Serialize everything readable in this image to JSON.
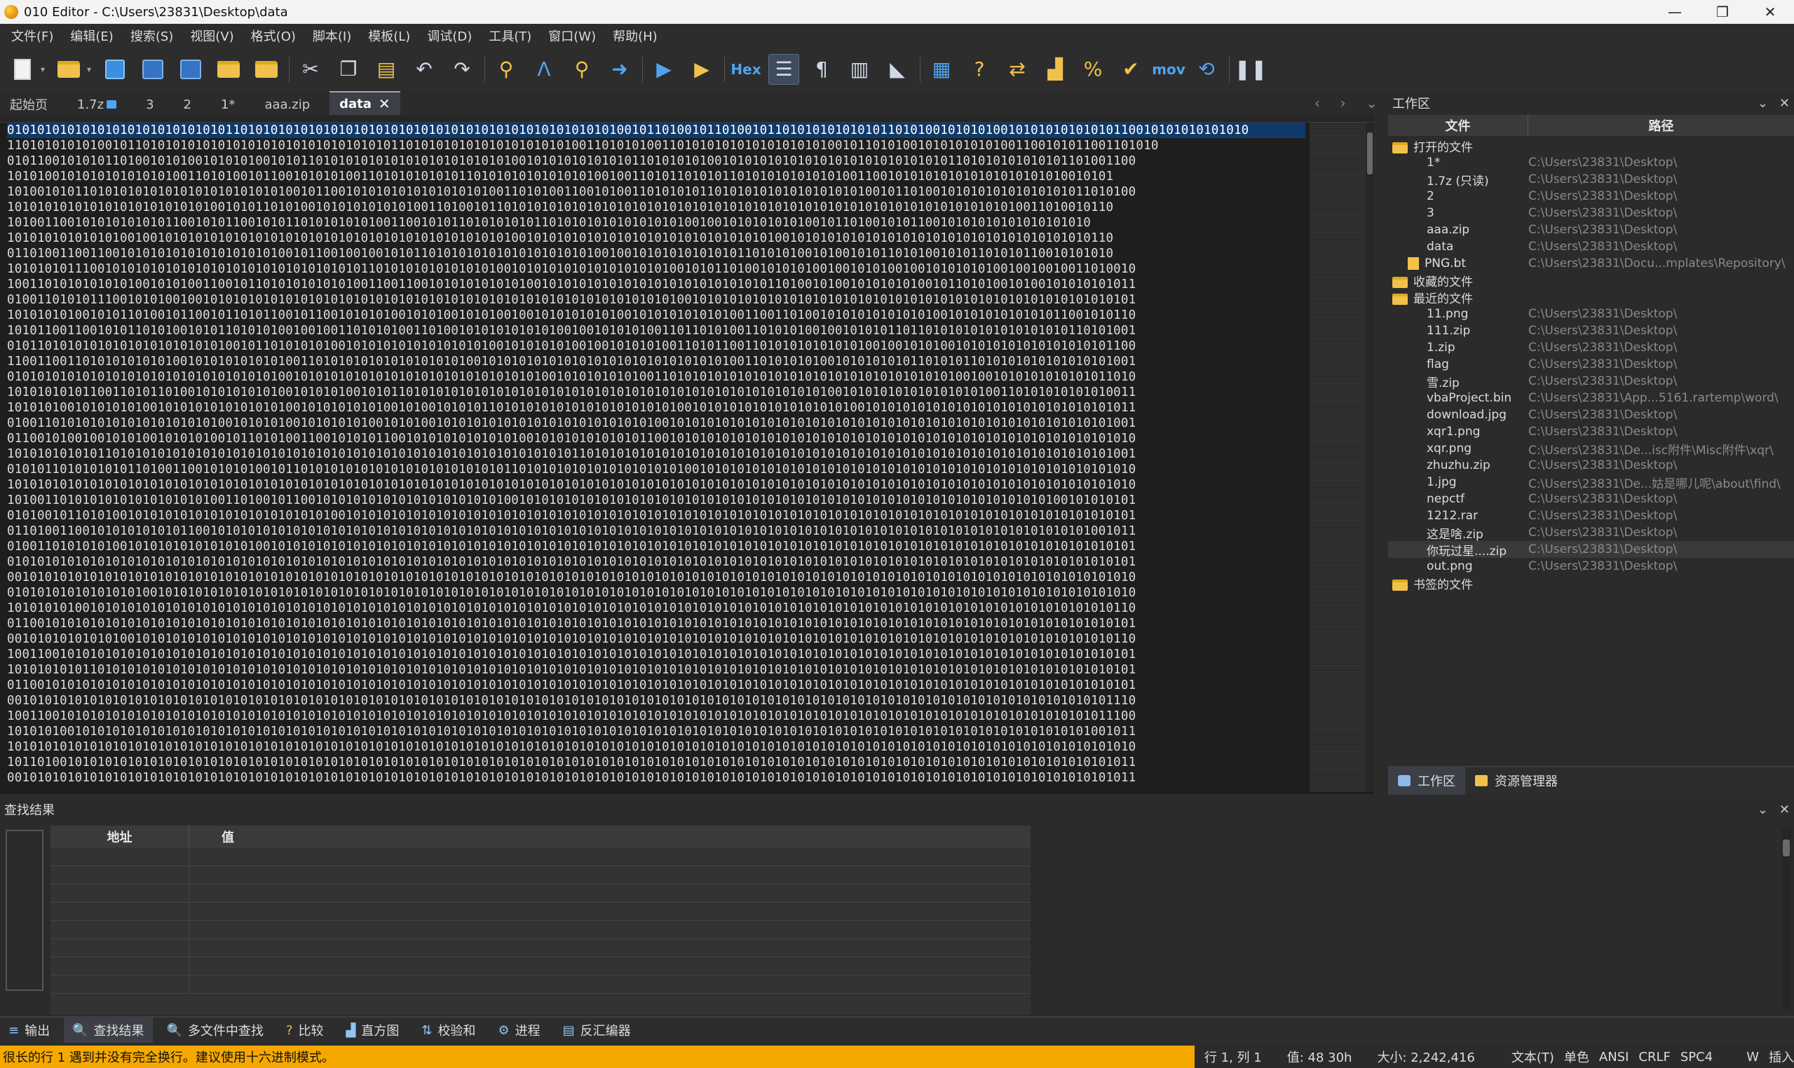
{
  "window": {
    "title": "010 Editor - C:\\Users\\23831\\Desktop\\data",
    "minimize": "—",
    "maximize": "❐",
    "close": "✕"
  },
  "menu": [
    "文件(F)",
    "编辑(E)",
    "搜索(S)",
    "视图(V)",
    "格式(O)",
    "脚本(I)",
    "模板(L)",
    "调试(D)",
    "工具(T)",
    "窗口(W)",
    "帮助(H)"
  ],
  "toolbar": {
    "hex_label": "Hex",
    "mov_label": "mov",
    "icons": [
      "new-file-icon",
      "open-folder-icon",
      "save-icon",
      "save-as-icon",
      "save-all-icon",
      "open-folder2-icon",
      "workspace-folder-icon",
      "cut-icon",
      "copy-icon",
      "paste-icon",
      "undo-icon",
      "redo-icon",
      "find-icon",
      "replace-icon",
      "find-in-files-icon",
      "goto-icon",
      "run-script-icon",
      "run-template-icon",
      "hex-mode-icon",
      "text-mode-icon",
      "show-whitespace-icon",
      "columns-icon",
      "highlight-icon",
      "calculator-icon",
      "inspector-icon",
      "compare-icon",
      "histogram-icon",
      "checksum-icon",
      "verify-icon",
      "disassembler-icon",
      "base-converter-icon",
      "pause-icon"
    ]
  },
  "tabs": [
    {
      "label": "起始页",
      "active": false,
      "locked": false
    },
    {
      "label": "1.7z",
      "active": false,
      "locked": true
    },
    {
      "label": "3",
      "active": false,
      "locked": false
    },
    {
      "label": "2",
      "active": false,
      "locked": false
    },
    {
      "label": "1*",
      "active": false,
      "locked": false
    },
    {
      "label": "aaa.zip",
      "active": false,
      "locked": false
    },
    {
      "label": "data",
      "active": true,
      "locked": false
    }
  ],
  "tab_close": "✕",
  "tab_nav": {
    "prev": "‹",
    "next": "›",
    "list": "⌄"
  },
  "editor": {
    "line_count": 43,
    "lines": [
      "010101010101010101010101010101101010101010101010101010101010101010101010101010101001011010010110100101101010101010101101010010101010010101010101010110010101010101010",
      "110101010101001011010101010101010101010101010101010110101010101010101010101001101010100110101010101010101010100101101010010101010101001100101011001101010",
      "010110010101011010010101001010101001010110101010101010101010101010100101010101010101101010101001010101010101010101010101010101101010101010101101001100",
      "101010010101010101010100110101001011001010101001101010101010110101010101010101001001101011010101101010101010101001100101010101010101010101010010101",
      "101001010110101010101010101010101010100101100101010101010101010100110101001100101001101010101101010101010101010101001011010010101010101010101011010100",
      "101010101010101010101010101001010110101001010101010101001101001011010101010101010101010101010101010101010101010101010101010101010101010011010010110",
      "101001100101010101010110010101100101011010101010100110010101101010101011010101010101010101001001010101010100101101001010110010101010101010101010",
      "101010101010101001001010101010101010101010101010101010101010101010100101010101010101010101010101010101001010101010101010101010101010101010101010110",
      "011010011001100101010101010101010101001011001001001010110101010101010101010101001001010101010101011010101001010010101101010010101101010110010101010",
      "101010101110010101010101010101010101010101010101101010101010101010010101010101010101010100101011010010101010010010101001001010101010010010010011010010",
      "100110101010101010010101001100101101010101010100110011001010101010101001010101010101010101010101010101101001010010101010100101101010010100101010101011",
      "010011010101110010101001001010101010101010101010101010101010101010101010101010101010101010010101010101010101010101010101010101010101010101010101010101",
      "101010101001010110100101100101101011001011001010101001010100101010010010101010101001010101010101001100110100101010101010101001010101010101011001010110",
      "101011001100101011010100101011010101001001001101010100110100101010101010100100101010100110110101001101010100100101010110110101010101010101010110101001",
      "010110101010101010101010101010010110101010100101010101010101010100101010101001001010101001101011001101010101010101001001010100101010101010101010101100",
      "110011001101010101010100101010101010100110101010101010101010100101010101010101010101010101010101001101010101001010101010110101011010101010101010101001",
      "010101010101010101010101010101010101001010101010101010101010101010101010010101010101001101010101010101010101010101010101010101001001010101010101011010",
      "101010101011001101011010010101010101001010101001010110101010101010101010101010101010101010101010101010101010100101010101010101010100110101010101010011",
      "101010100101010101001010101010101010100101010101010010100101010110101010101010101010101010010101010101010101010100101010101010101010101010101010101011",
      "010011010101010101010101010100101010100101010101001010100101010101010101010101010101010010101010101010101010101010101010101010101010101010101010101001",
      "011001010010010101001010101001011010100110010101011001010101010101010010101010101010110010101010101010101010101010101010101010101010101010101010101010",
      "101010101010110101010101010101010101010101010101010101010101010101010101010110101010101010101010101010101010101010101010101010101010101010101010101001",
      "010101101010101011010011001010101001011010101010101010101010101010110101010101010101010101001010101010101010101010101010101010101010101010101010101010",
      "101010101010101010101010101010101010101010101010101010101010101010101010101010101010101010101010101010101010101010101010101010101010101010101010101010",
      "101001101010101010101010101001101001011001010101010101010101010101001010101010101010101010101010101010101010101010101010101010101010101010100101010101",
      "010100101101010010101010101010101010101010100101010101010101010101010101010101010101010101010101010101010101010101010101010101010101010101010101010101",
      "011010011001010101010101100101010101010101010101010101010101010101010101010101010101010101010101010101010101010101010101010101010101010101010101001011",
      "010011010101010010101010101010101001010101010101010101010101010101010101010101010101010101010101010101010101010101010101010101010101010101010101010101",
      "010101010101010101010101010101010101010101010101010101010101010101010101010101010101010101010101010101010101010101010101010101010101010101010101010101",
      "001010101010101010101010101010101010101010101010101010101010101010101010101010101010101010101010101010101010101010101010101010101010101010101010101010",
      "010101010101010101001010101010101010101010101010101010101010101010101010101010101010101010101010101010101010101010101010101010101010101010101010101010",
      "101010101001010101010101010101010101010101010101010101010101010101010101010101010101010101010101010101010101010101010101010101010101010101010101010110",
      "011001010101010101010101010101010101010101010101010101010101010101010101010101010101010101010101010101010101010101010101010101010101010101010101010101",
      "001010101010101001010101010101010101010101010101010101010101010101010101010101010101010101010101010101010101010101010101010101010101010101010101010110",
      "100110010101010101010101010101010101010101010101010101010101010101010101010101010101010101010101010101010101010101010101010101010101010101010101010101",
      "101010101011010101010101010101010101010101010101010101010101010101010101010101010101010101010101010101010101010101010101010101010101010101010101010101",
      "011001010101010101010101010101010101010101010101010101010101010101010101010101010101010101010101010101010101010101010101010101010101010101010101010101",
      "001010101010101010101010101010101010101010101010101010101010101010101010101010101010101010101010101010101010101010101010101010101010101010101010101110",
      "100110010101010101010101010101010101010101010101010101010101010101010101010101010101010101010101010101010101010101010101010101010101010101010101011100",
      "101010100101010101010101010101010101010101010101010101010101010101010101010101010101010101010101010101010101010101010101010101010101010101010101001011",
      "101010101010101010101010101010101010101010101010101010101010101010101010101010101010101010101010101010101010101010101010101010101010101010101010101010",
      "101101001010101010101010101010101010101010101010101010101010101010101010101010101010101010101010101010101010101010101010101010101010101010101010101011",
      "001010101010101010101010101010101010101010101010101010101010101010101010101010101010101010101010101010101010101010101010101010101010101010101010101011"
    ]
  },
  "workspace": {
    "title": "工作区",
    "col_file": "文件",
    "col_path": "路径",
    "groups": [
      {
        "label": "打开的文件",
        "items": [
          {
            "name": "1*",
            "path": "C:\\Users\\23831\\Desktop\\"
          },
          {
            "name": "1.7z (只读)",
            "path": "C:\\Users\\23831\\Desktop\\"
          },
          {
            "name": "2",
            "path": "C:\\Users\\23831\\Desktop\\"
          },
          {
            "name": "3",
            "path": "C:\\Users\\23831\\Desktop\\"
          },
          {
            "name": "aaa.zip",
            "path": "C:\\Users\\23831\\Desktop\\"
          },
          {
            "name": "data",
            "path": "C:\\Users\\23831\\Desktop\\"
          }
        ],
        "bt": {
          "name": "PNG.bt",
          "path": "C:\\Users\\23831\\Docu...mplates\\Repository\\"
        }
      },
      {
        "label": "收藏的文件",
        "items": []
      },
      {
        "label": "最近的文件",
        "items": [
          {
            "name": "11.png",
            "path": "C:\\Users\\23831\\Desktop\\"
          },
          {
            "name": "111.zip",
            "path": "C:\\Users\\23831\\Desktop\\"
          },
          {
            "name": "1.zip",
            "path": "C:\\Users\\23831\\Desktop\\"
          },
          {
            "name": "flag",
            "path": "C:\\Users\\23831\\Desktop\\"
          },
          {
            "name": "雪.zip",
            "path": "C:\\Users\\23831\\Desktop\\"
          },
          {
            "name": "vbaProject.bin",
            "path": "C:\\Users\\23831\\App...5161.rartemp\\word\\"
          },
          {
            "name": "download.jpg",
            "path": "C:\\Users\\23831\\Desktop\\"
          },
          {
            "name": "xqr1.png",
            "path": "C:\\Users\\23831\\Desktop\\"
          },
          {
            "name": "xqr.png",
            "path": "C:\\Users\\23831\\De...isc附件\\Misc附件\\xqr\\"
          },
          {
            "name": "zhuzhu.zip",
            "path": "C:\\Users\\23831\\Desktop\\"
          },
          {
            "name": "1.jpg",
            "path": "C:\\Users\\23831\\De...姑是哪儿呢\\about\\find\\"
          },
          {
            "name": "nepctf",
            "path": "C:\\Users\\23831\\Desktop\\"
          },
          {
            "name": "1212.rar",
            "path": "C:\\Users\\23831\\Desktop\\"
          },
          {
            "name": "这是啥.zip",
            "path": "C:\\Users\\23831\\Desktop\\"
          },
          {
            "name": "你玩过星....zip",
            "path": "C:\\Users\\23831\\Desktop\\",
            "highlight": true
          },
          {
            "name": "out.png",
            "path": "C:\\Users\\23831\\Desktop\\"
          }
        ]
      },
      {
        "label": "书签的文件",
        "items": []
      }
    ],
    "bottom_tabs": [
      "工作区",
      "资源管理器"
    ]
  },
  "find_results": {
    "title": "查找结果",
    "col_address": "地址",
    "col_value": "值"
  },
  "bottom_tabs": [
    "输出",
    "查找结果",
    "多文件中查找",
    "比较",
    "直方图",
    "校验和",
    "进程",
    "反汇编器"
  ],
  "bottom_tab_icons": [
    "output-icon",
    "find-results-icon",
    "find-in-files-icon",
    "compare-icon",
    "histogram-icon",
    "checksum-icon",
    "process-icon",
    "disassembler-icon"
  ],
  "panel_ctrls": {
    "dropdown": "⌄",
    "close": "✕"
  },
  "status": {
    "message": "很长的行 1 遇到并没有完全换行。建议使用十六进制模式。",
    "position": "行 1, 列 1",
    "value": "值: 48 30h",
    "size": "大小: 2,242,416",
    "mode": "文本(T)",
    "byte": "单色",
    "encoding": "ANSI",
    "line_end": "CRLF",
    "spacing": "SPC4",
    "write": "W",
    "insert": "插入"
  }
}
